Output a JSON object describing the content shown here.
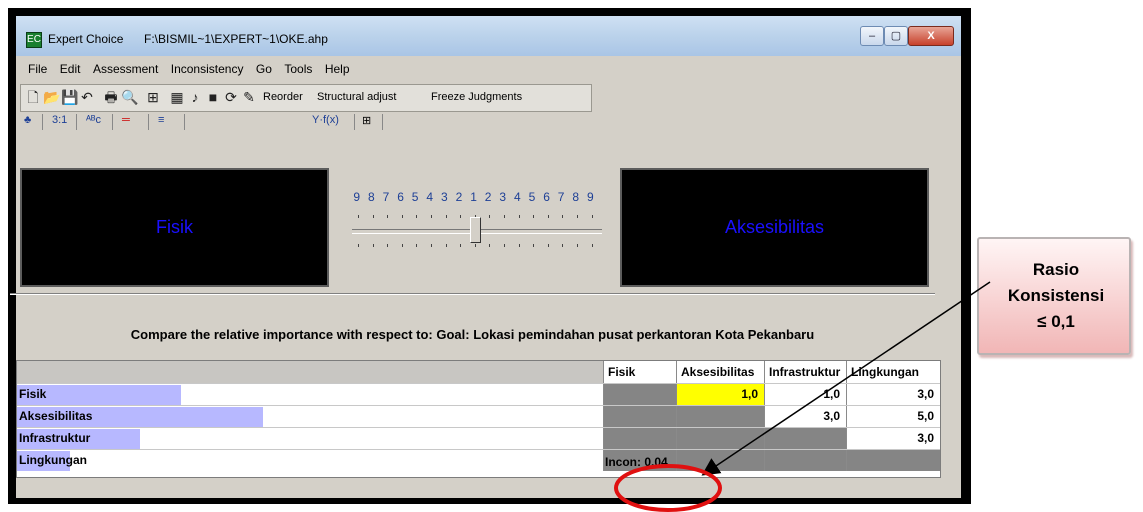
{
  "window": {
    "app_title": "Expert Choice",
    "file_path": "F:\\BISMIL~1\\EXPERT~1\\OKE.ahp",
    "app_icon_glyph": "EC",
    "min_glyph": "–",
    "max_glyph": "▢",
    "close_glyph": "X"
  },
  "menu": {
    "items": [
      "File",
      "Edit",
      "Assessment",
      "Inconsistency",
      "Go",
      "Tools",
      "Help"
    ]
  },
  "toolbar": {
    "icons": [
      "new-file-icon",
      "open-folder-icon",
      "save-icon",
      "undo-icon",
      "print-icon",
      "print-preview-icon",
      "hierarchy-icon",
      "calculator-icon",
      "sound-icon",
      "square-icon",
      "refresh-icon",
      "magic-wand-icon"
    ],
    "glyphs": [
      "🗋",
      "📂",
      "💾",
      "↶",
      "🖶",
      "🔍",
      "⊞",
      "▦",
      "♪",
      "■",
      "⟳",
      "✎"
    ],
    "reorder_label": "Reorder",
    "structural_label": "Structural adjust",
    "freeze_label": "Freeze Judgments"
  },
  "tabs": {
    "items": [
      "3:1",
      "ABC",
      "",
      "",
      "Y-f(x)",
      ""
    ],
    "glyphs": [
      "♣",
      "3:1",
      "ᴬᴮᴄ",
      "═",
      "≡",
      "Y·f(x)",
      "⊞"
    ]
  },
  "comparison": {
    "left_label": "Fisik",
    "right_label": "Aksesibilitas",
    "scale": [
      "9",
      "8",
      "7",
      "6",
      "5",
      "4",
      "3",
      "2",
      "1",
      "2",
      "3",
      "4",
      "5",
      "6",
      "7",
      "8",
      "9"
    ],
    "slider_value": 1,
    "prompt": "Compare the relative importance  with respect to: Goal: Lokasi pemindahan pusat perkantoran Kota Pekanbaru"
  },
  "matrix": {
    "columns": [
      "Fisik",
      "Aksesibilitas",
      "Infrastruktur",
      "Lingkungan"
    ],
    "rows": [
      {
        "label": "Fisik",
        "bar_fraction": 0.28,
        "cells": [
          "",
          "1,0",
          "1,0",
          "3,0"
        ]
      },
      {
        "label": "Aksesibilitas",
        "bar_fraction": 0.42,
        "cells": [
          "",
          "",
          "3,0",
          "5,0"
        ]
      },
      {
        "label": "Infrastruktur",
        "bar_fraction": 0.21,
        "cells": [
          "",
          "",
          "",
          "3,0"
        ]
      },
      {
        "label": "Lingkungan",
        "bar_fraction": 0.09,
        "cells": [
          "",
          "",
          "",
          ""
        ]
      }
    ],
    "incon_label": "Incon: 0,04"
  },
  "callout": {
    "line1": "Rasio",
    "line2": "Konsistensi",
    "line3": "≤ 0,1"
  },
  "colors": {
    "highlight_circle": "#e01010",
    "row_bar": "#b7b8ff",
    "selected_cell": "#ffff00",
    "label_text": "#1a10ff"
  }
}
